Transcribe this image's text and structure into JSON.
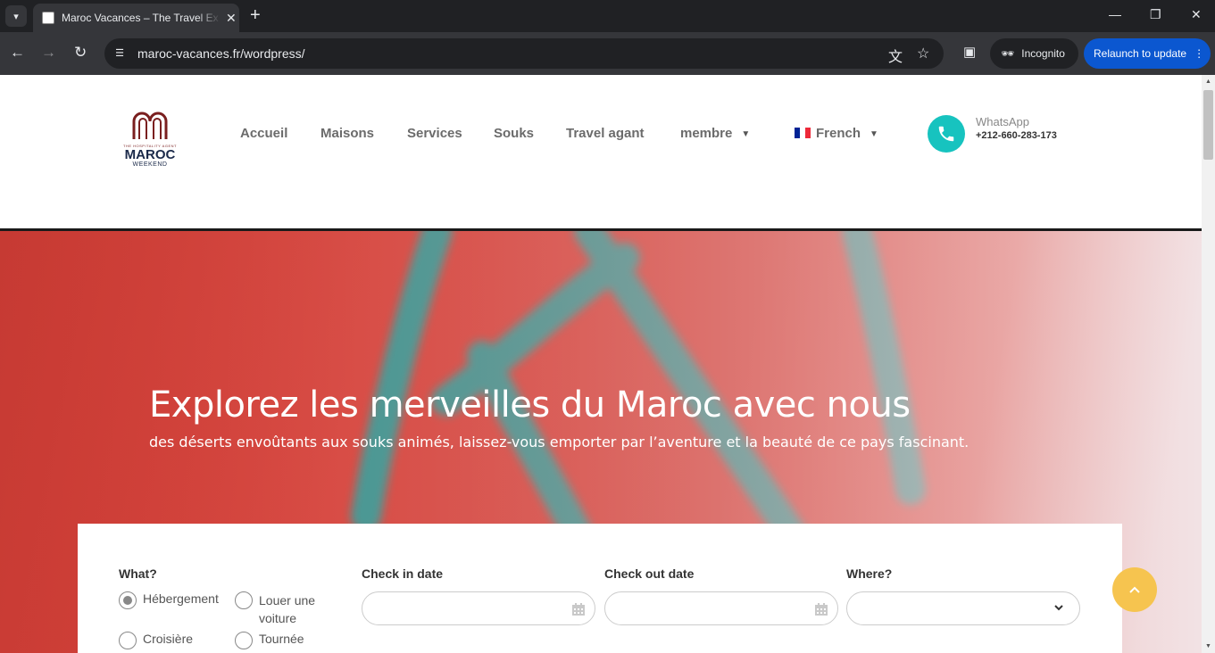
{
  "browser": {
    "tab_title": "Maroc Vacances – The Travel Ex",
    "url": "maroc-vacances.fr/wordpress/",
    "incognito_label": "Incognito",
    "relaunch_label": "Relaunch to update"
  },
  "header": {
    "logo": {
      "small_text": "THE HOSPITALITY AGENT",
      "main_text": "MAROC",
      "sub_text": "WEEKEND"
    },
    "nav": [
      "Accueil",
      "Maisons",
      "Services",
      "Souks",
      "Travel agant",
      "membre"
    ],
    "language": "French",
    "whatsapp_label": "WhatsApp",
    "whatsapp_number": "+212-660-283-173"
  },
  "hero": {
    "title": "Explorez les merveilles du Maroc avec nous",
    "subtitle": "des déserts envoûtants aux souks animés, laissez-vous emporter par l’aventure et la beauté de ce pays fascinant."
  },
  "search": {
    "what_label": "What?",
    "options": [
      "Hébergement",
      "Louer une voiture",
      "Croisière",
      "Tournée"
    ],
    "selected_option": "Hébergement",
    "checkin_label": "Check in date",
    "checkout_label": "Check out date",
    "where_label": "Where?",
    "checkin_value": "",
    "checkout_value": "",
    "where_value": ""
  },
  "colors": {
    "accent_teal": "#17c3bf",
    "to_top_yellow": "#f6c44f",
    "hero_red": "#d9453d"
  }
}
